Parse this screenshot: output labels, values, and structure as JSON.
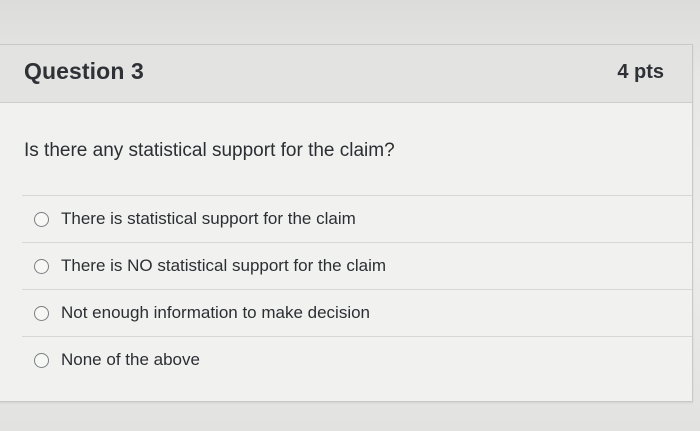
{
  "question": {
    "title": "Question 3",
    "points": "4 pts",
    "prompt": "Is there any statistical support for the claim?",
    "options": [
      {
        "label": "There is statistical support for the claim",
        "selected": false
      },
      {
        "label": "There is NO statistical support for the claim",
        "selected": false
      },
      {
        "label": "Not enough information to make decision",
        "selected": false
      },
      {
        "label": "None of the above",
        "selected": false
      }
    ]
  }
}
